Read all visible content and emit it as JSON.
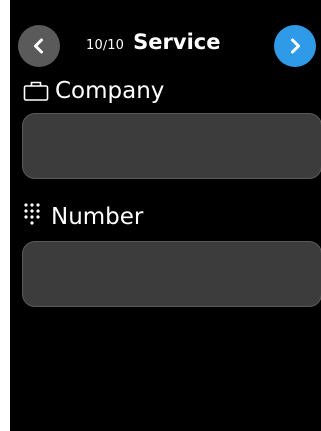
{
  "header": {
    "counter_current": "10",
    "counter_separator": "/",
    "counter_total": "10",
    "title": "Service",
    "back_icon": "chevron-left-icon",
    "next_icon": "chevron-right-icon"
  },
  "fields": {
    "company": {
      "icon": "briefcase-icon",
      "label": "Company",
      "value": "",
      "placeholder": ""
    },
    "number": {
      "icon": "keypad-icon",
      "label": "Number",
      "value": "",
      "placeholder": ""
    }
  },
  "colors": {
    "background": "#000000",
    "back_button": "#5a5a5a",
    "next_button": "#2f9be8",
    "field_fill": "#3c3c3c",
    "field_border": "#5a5a5a",
    "text": "#ffffff"
  }
}
